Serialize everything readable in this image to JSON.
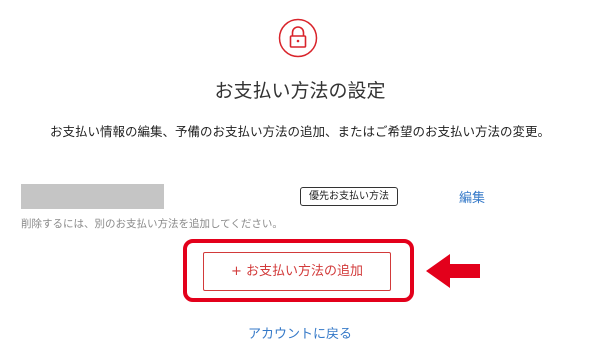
{
  "header": {
    "icon": "lock-icon",
    "title": "お支払い方法の設定",
    "description": "お支払い情報の編集、予備のお支払い方法の追加、またはご希望のお支払い方法の変更。"
  },
  "payment_method": {
    "badge_label": "優先お支払い方法",
    "edit_label": "編集",
    "delete_hint": "削除するには、別のお支払い方法を追加してください。"
  },
  "actions": {
    "add_label": "+ お支払い方法の追加",
    "back_label": "アカウントに戻る"
  },
  "annotation": {
    "highlight_color": "#e3001b",
    "arrow_icon": "left-arrow-icon"
  },
  "colors": {
    "accent": "#d23a3a",
    "link": "#3579c8"
  }
}
